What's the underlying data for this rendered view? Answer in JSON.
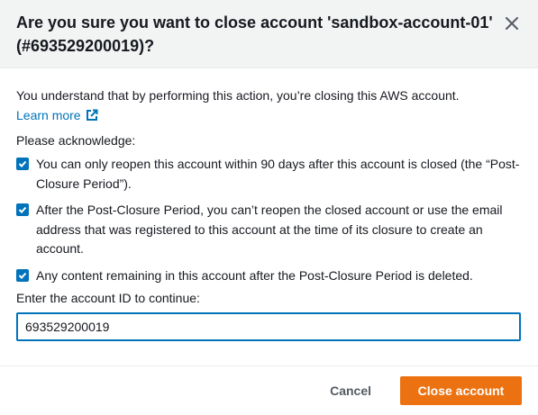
{
  "modal": {
    "title": "Are you sure you want to close account 'sandbox-account-01' (#693529200019)?",
    "close_icon": "close-icon"
  },
  "body": {
    "intro": "You understand that by performing this action, you’re closing this AWS account.",
    "learn_more": "Learn more",
    "learn_more_icon": "external-link-icon",
    "ack_title": "Please acknowledge:",
    "acknowledgements": [
      {
        "checked": true,
        "text": "You can only reopen this account within 90 days after this account is closed (the “Post-Closure Period”)."
      },
      {
        "checked": true,
        "text": "After the Post-Closure Period, you can’t reopen the closed account or use the email address that was registered to this account at the time of its closure to create an account."
      },
      {
        "checked": true,
        "text": "Any content remaining in this account after the Post-Closure Period is deleted."
      }
    ],
    "input_label": "Enter the account ID to continue:",
    "input_value": "693529200019"
  },
  "footer": {
    "cancel_label": "Cancel",
    "confirm_label": "Close account"
  },
  "colors": {
    "accent": "#0073bb",
    "primary_button": "#ec7211",
    "header_bg": "#f2f3f3"
  }
}
